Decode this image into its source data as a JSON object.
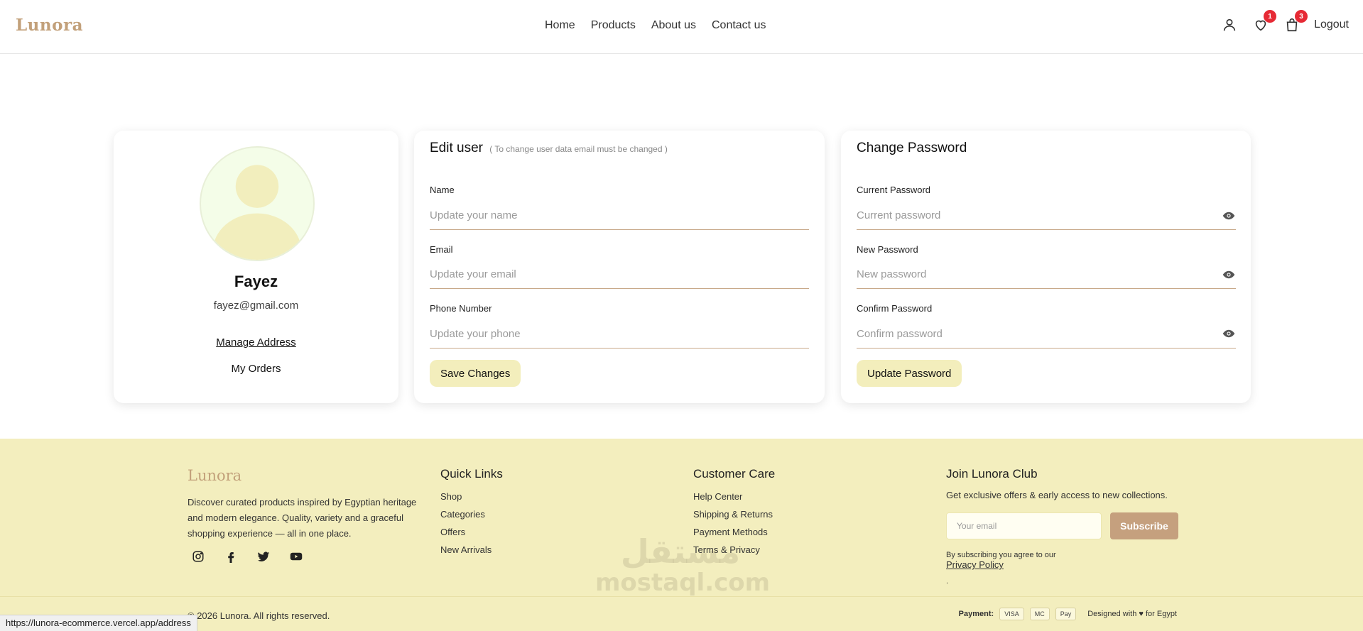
{
  "header": {
    "logo": "Lunora",
    "nav": [
      "Home",
      "Products",
      "About us",
      "Contact us"
    ],
    "wishlist_count": "1",
    "cart_count": "3",
    "logout": "Logout"
  },
  "profile": {
    "name": "Fayez",
    "email": "fayez@gmail.com",
    "manage_address": "Manage Address",
    "my_orders": "My Orders"
  },
  "edit_user": {
    "title": "Edit user",
    "note": "( To change user data email must be changed )",
    "name_label": "Name",
    "name_placeholder": "Update your name",
    "email_label": "Email",
    "email_placeholder": "Update your email",
    "phone_label": "Phone Number",
    "phone_placeholder": "Update your phone",
    "save_button": "Save Changes"
  },
  "change_password": {
    "title": "Change Password",
    "current_label": "Current Password",
    "current_placeholder": "Current password",
    "new_label": "New Password",
    "new_placeholder": "New password",
    "confirm_label": "Confirm Password",
    "confirm_placeholder": "Confirm password",
    "update_button": "Update Password"
  },
  "footer": {
    "logo": "Lunora",
    "description": "Discover curated products inspired by Egyptian heritage and modern elegance. Quality, variety and a graceful shopping experience — all in one place.",
    "quick_links_title": "Quick Links",
    "quick_links": [
      "Shop",
      "Categories",
      "Offers",
      "New Arrivals"
    ],
    "customer_care_title": "Customer Care",
    "customer_care": [
      "Help Center",
      "Shipping & Returns",
      "Payment Methods",
      "Terms & Privacy"
    ],
    "club_title": "Join Lunora Club",
    "club_text": "Get exclusive offers & early access to new collections.",
    "email_placeholder": "Your email",
    "subscribe": "Subscribe",
    "sub_note_prefix": "By subscribing you agree to our",
    "privacy_policy": "Privacy Policy",
    "sub_note_suffix": ".",
    "copyright": "© 2026 Lunora. All rights reserved.",
    "payment_label": "Payment:",
    "payment_methods": [
      "VISA",
      "MC",
      "Pay"
    ],
    "designed": "Designed with ♥ for Egypt"
  },
  "watermark": {
    "line1": "مستقل",
    "line2": "mostaql.com"
  },
  "status_url": "https://lunora-ecommerce.vercel.app/address",
  "colors": {
    "brand": "#c2a07a",
    "button": "#f3eebc",
    "footer_bg": "#f3eebe",
    "badge": "#e62a35",
    "subscribe_btn": "#c5a07e"
  }
}
